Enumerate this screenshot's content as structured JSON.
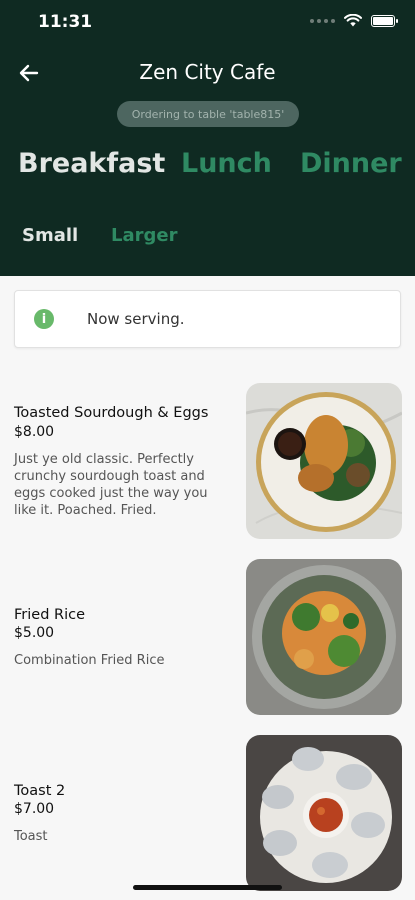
{
  "status_bar": {
    "time": "11:31"
  },
  "header": {
    "title": "Zen City Cafe",
    "table_notice": "Ordering to table 'table815'",
    "meal_tabs": [
      "Breakfast",
      "Lunch",
      "Dinner"
    ],
    "size_tabs": [
      "Small",
      "Larger"
    ]
  },
  "notice": {
    "text": "Now serving."
  },
  "menu": [
    {
      "name": "Toasted Sourdough & Eggs",
      "price": "$8.00",
      "description": "Just ye old classic. Perfectly crunchy sourdough toast and eggs cooked just the way you like it. Poached. Fried."
    },
    {
      "name": "Fried Rice",
      "price": "$5.00",
      "description": "Combination Fried Rice"
    },
    {
      "name": "Toast 2",
      "price": "$7.00",
      "description": "Toast"
    }
  ],
  "colors": {
    "header_bg": "#0f2a22",
    "accent_green": "#2f8a63",
    "info_green": "#68b96a"
  }
}
